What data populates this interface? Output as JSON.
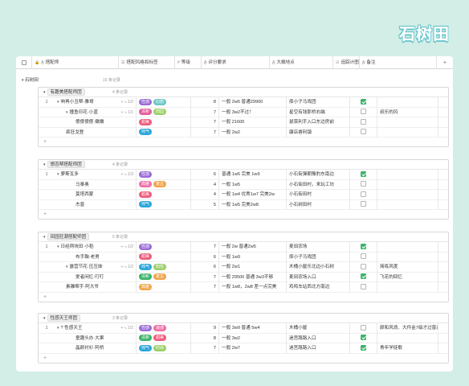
{
  "watermark": "石树田",
  "header": {
    "name_label": "搭配师",
    "style_label": "搭配风格和标签",
    "level_label": "等级",
    "eval_label": "评分要求",
    "map_label": "大概地点",
    "done_label": "追踪计图",
    "note_label": "备注"
  },
  "top_group": {
    "label": "石树田",
    "count": "16 条记录"
  },
  "groups": [
    {
      "title": "有趣美搭配师团",
      "count": "4 条记录",
      "rows": [
        {
          "num": "1",
          "name": "响再小丑帮·雅哥",
          "sub": "1/2",
          "indent": 0,
          "tri": true,
          "tags": [
            {
              "t": "性感",
              "c": "#9b6cd8"
            },
            {
              "t": "幻想",
              "c": "#6fc6c4"
            }
          ],
          "level": "8",
          "eval": "一般 2w5 普通29900",
          "map": "摔小子马戏团",
          "done": true,
          "note": ""
        },
        {
          "num": "",
          "name": "撞鱼印花·小蓝",
          "sub": "1/1",
          "indent": 1,
          "tri": true,
          "tags": [
            {
              "t": "清新",
              "c": "#e25d9a"
            },
            {
              "t": "田园",
              "c": "#9bcf6a"
            }
          ],
          "level": "7",
          "eval": "一般 3w2不过！",
          "map": "星空有钱那桥右端",
          "done": false,
          "note": "叔乐的风"
        },
        {
          "num": "",
          "name": "傻傻傻傻·嫩嫩",
          "sub": "",
          "indent": 2,
          "tri": false,
          "tags": [
            {
              "t": "甜美",
              "c": "#ef5b7c"
            }
          ],
          "level": "7",
          "eval": "一般 21600",
          "map": "鼠菜利手入口东边房前",
          "done": false,
          "note": ""
        },
        {
          "num": "",
          "name": "疯狂戈登",
          "sub": "",
          "indent": 1,
          "tri": false,
          "tags": [
            {
              "t": "帅气",
              "c": "#2ea7d8"
            }
          ],
          "level": "7",
          "eval": "一般 2w2",
          "map": "康店睿利镇",
          "done": false,
          "note": ""
        }
      ]
    },
    {
      "title": "想否帮搭配师团",
      "count": "4 条记录",
      "rows": [
        {
          "num": "1",
          "name": "萝斯瓦多",
          "sub": "1/3",
          "indent": 0,
          "tri": true,
          "tags": [
            {
              "t": "性感",
              "c": "#9b6cd8"
            }
          ],
          "level": "6",
          "eval": "普通 1w5 完美 1w9",
          "map": "小石街彈朝豫豹东南边",
          "done": true,
          "note": ""
        },
        {
          "num": "",
          "name": "马泰奥",
          "sub": "",
          "indent": 2,
          "tri": false,
          "tags": [
            {
              "t": "典雅",
              "c": "#ef6fa6"
            },
            {
              "t": "复古",
              "c": "#f0a54c"
            }
          ],
          "level": "4",
          "eval": "一般 1w5",
          "map": "小石街田村，来玩工坊",
          "done": false,
          "note": ""
        },
        {
          "num": "",
          "name": "莫塔西蒙",
          "sub": "",
          "indent": 2,
          "tri": false,
          "tags": [
            {
              "t": "甜美",
              "c": "#ef5b7c"
            }
          ],
          "level": "4",
          "eval": "一般 1w4 优秀1w7 完美2w",
          "map": "小石街田村",
          "done": false,
          "note": ""
        },
        {
          "num": "",
          "name": "杰普",
          "sub": "",
          "indent": 2,
          "tri": false,
          "tags": [
            {
              "t": "帅气",
              "c": "#2ea7d8"
            }
          ],
          "level": "5",
          "eval": "一般 1w5 完美2w8",
          "map": "小石树田村",
          "done": false,
          "note": ""
        }
      ]
    },
    {
      "title": "田园狂潮搭配师团",
      "count": "5 条记录",
      "rows": [
        {
          "num": "1",
          "name": "日经两块田·小稻",
          "sub": "1/2",
          "indent": 0,
          "tri": true,
          "tags": [
            {
              "t": "性感",
              "c": "#9b6cd8"
            }
          ],
          "level": "7",
          "eval": "一般 2w 普通2w5",
          "map": "麦田农场",
          "done": true,
          "note": ""
        },
        {
          "num": "",
          "name": "布手鞠·老男",
          "sub": "",
          "indent": 2,
          "tri": false,
          "tags": [
            {
              "t": "甜美",
              "c": "#ef5b7c"
            }
          ],
          "level": "6",
          "eval": "一般 1w9",
          "map": "摔小子马戏团",
          "done": false,
          "note": ""
        },
        {
          "num": "",
          "name": "露营节花·压压妹",
          "sub": "1/2",
          "indent": 1,
          "tri": true,
          "tags": [
            {
              "t": "帅气",
              "c": "#2ea7d8"
            },
            {
              "t": "知性",
              "c": "#9bcf6a"
            }
          ],
          "level": "6",
          "eval": "一般 2w1",
          "map": "木桶小屋乐北边小石树",
          "done": false,
          "note": "简练风度"
        },
        {
          "num": "",
          "name": "爱者闲忆·叮叮",
          "sub": "",
          "indent": 2,
          "tri": false,
          "tags": [
            {
              "t": "清新",
              "c": "#3bb36a"
            },
            {
              "t": "复古",
              "c": "#f0a54c"
            }
          ],
          "level": "7",
          "eval": "一般 29500 普通 3w3不够",
          "map": "麦田农场入口",
          "done": true,
          "note": "飞花的回忆"
        },
        {
          "num": "",
          "name": "素雕帮手·阿大爷",
          "sub": "",
          "indent": 1,
          "tri": false,
          "tags": [
            {
              "t": "典雅",
              "c": "#f0a54c"
            }
          ],
          "level": "7",
          "eval": "一般 1w8，2w8 差一点完美",
          "map": "鸡鸣车站西北方南边",
          "done": false,
          "note": ""
        }
      ]
    },
    {
      "title": "性感天王师团",
      "count": "3 条记录",
      "rows": [
        {
          "num": "1",
          "name": "? 性感天王",
          "sub": "1/2",
          "indent": 0,
          "tri": true,
          "tags": [
            {
              "t": "性感",
              "c": "#9b6cd8"
            },
            {
              "t": "浪漫",
              "c": "#ef6fa6"
            }
          ],
          "level": "9",
          "eval": "一般 3w9 普通 5w4",
          "map": "木桶小屋",
          "done": false,
          "note": "颜和风浪、大件金7级才过普通"
        },
        {
          "num": "",
          "name": "童趣头办·大果",
          "sub": "",
          "indent": 2,
          "tri": false,
          "tags": [
            {
              "t": "清新",
              "c": "#3bb36a"
            },
            {
              "t": "甜美",
              "c": "#ef5b7c"
            }
          ],
          "level": "8",
          "eval": "一般 3w2",
          "map": "迷宫路路入口",
          "done": true,
          "note": ""
        },
        {
          "num": "",
          "name": "晶颜衬衫·阿桥",
          "sub": "",
          "indent": 2,
          "tri": false,
          "tags": [
            {
              "t": "帅气",
              "c": "#2ea7d8"
            },
            {
              "t": "时尚",
              "c": "#9bcf6a"
            }
          ],
          "level": "7",
          "eval": "一般 2w7",
          "map": "迷宫路路入口",
          "done": true,
          "note": "青年学徒歌"
        }
      ]
    }
  ]
}
